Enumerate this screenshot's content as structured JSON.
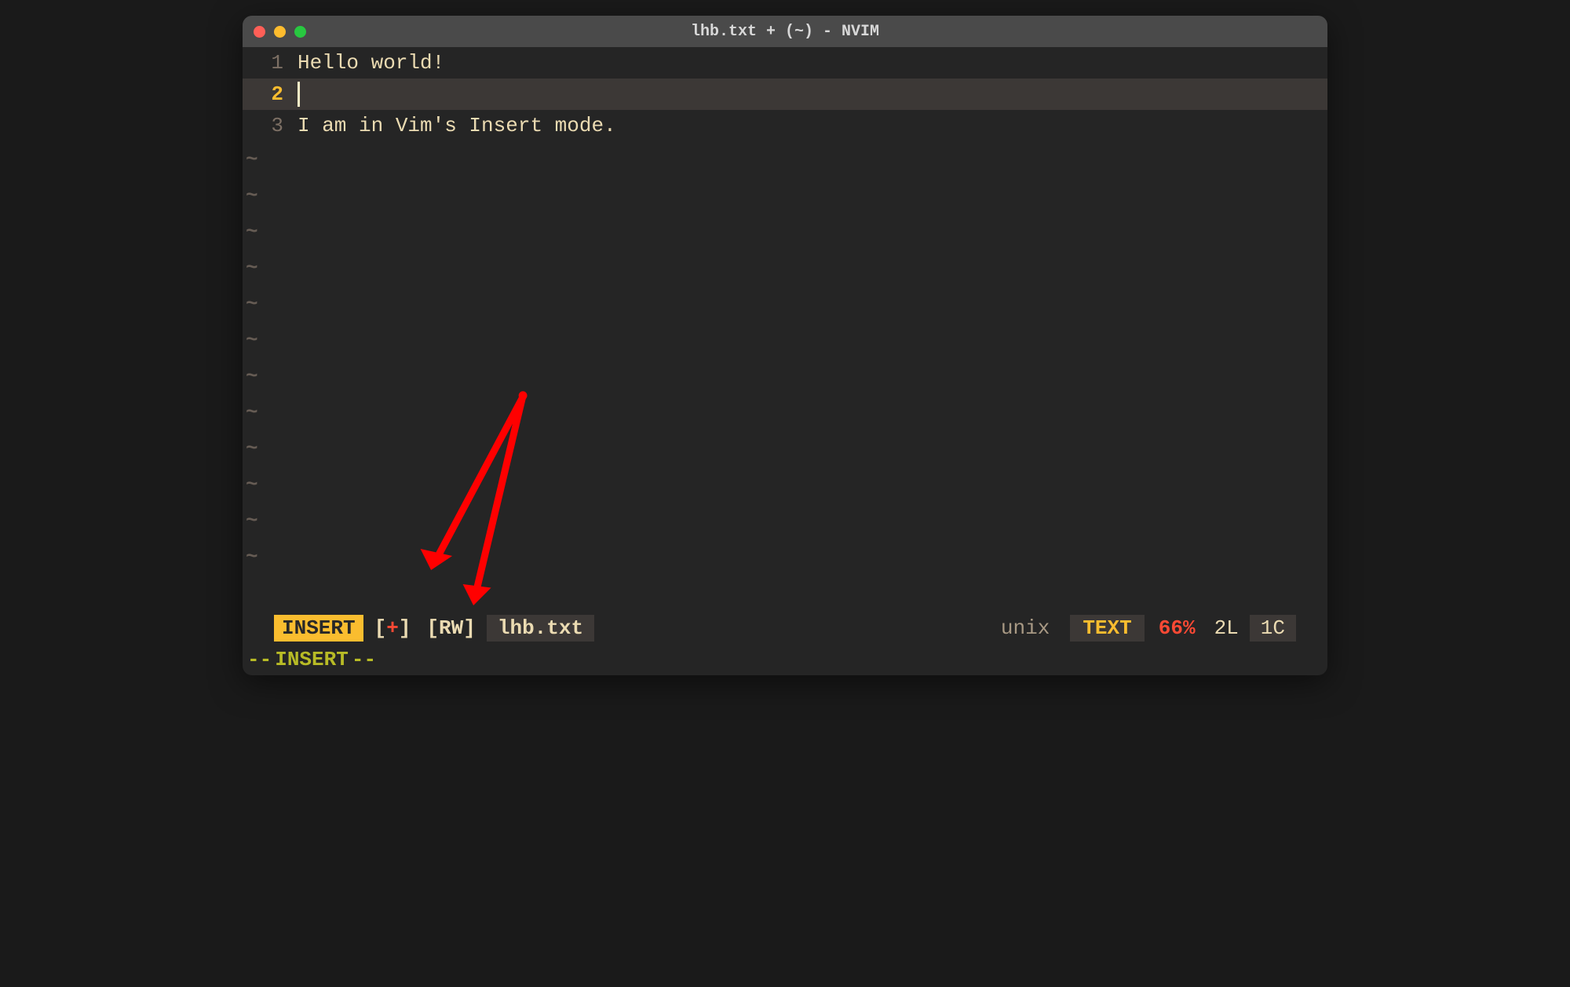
{
  "window": {
    "title": "lhb.txt + (~) - NVIM"
  },
  "editor": {
    "lines": [
      {
        "number": "1",
        "content": "Hello world!",
        "current": false
      },
      {
        "number": "2",
        "content": "",
        "current": true
      },
      {
        "number": "3",
        "content": "I am in Vim's Insert mode.",
        "current": false
      }
    ],
    "tilde_count": 12
  },
  "statusline": {
    "mode": "INSERT",
    "modified_prefix": "[",
    "modified_symbol": "+",
    "modified_suffix": "]",
    "readwrite": "[RW]",
    "filename": "lhb.txt",
    "fileformat": "unix",
    "filetype": "TEXT",
    "percent": "66%",
    "line": "2L",
    "col": "1C"
  },
  "commandline": {
    "prefix": "--",
    "mode": "INSERT",
    "suffix": "--"
  },
  "tilde_char": "~"
}
